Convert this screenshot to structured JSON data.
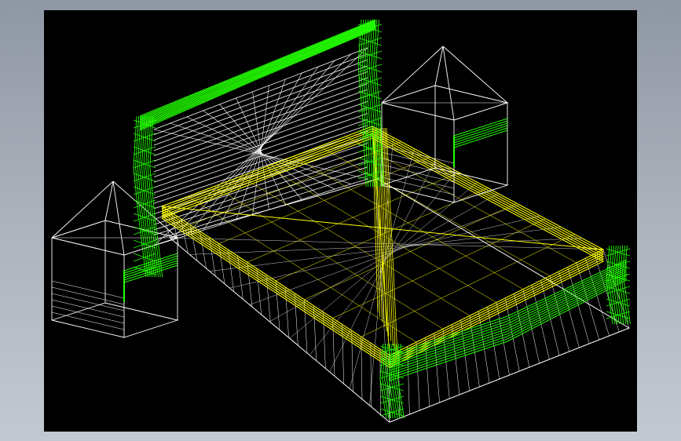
{
  "model_viewport": {
    "background_color": "#000000",
    "wire_colors": {
      "frame": "#ffffff",
      "trim": "#22ff00",
      "mattress": "#ffff00"
    },
    "objects": [
      "bed-frame",
      "headboard",
      "footboard",
      "mattress",
      "left-nightstand",
      "right-nightstand"
    ]
  }
}
